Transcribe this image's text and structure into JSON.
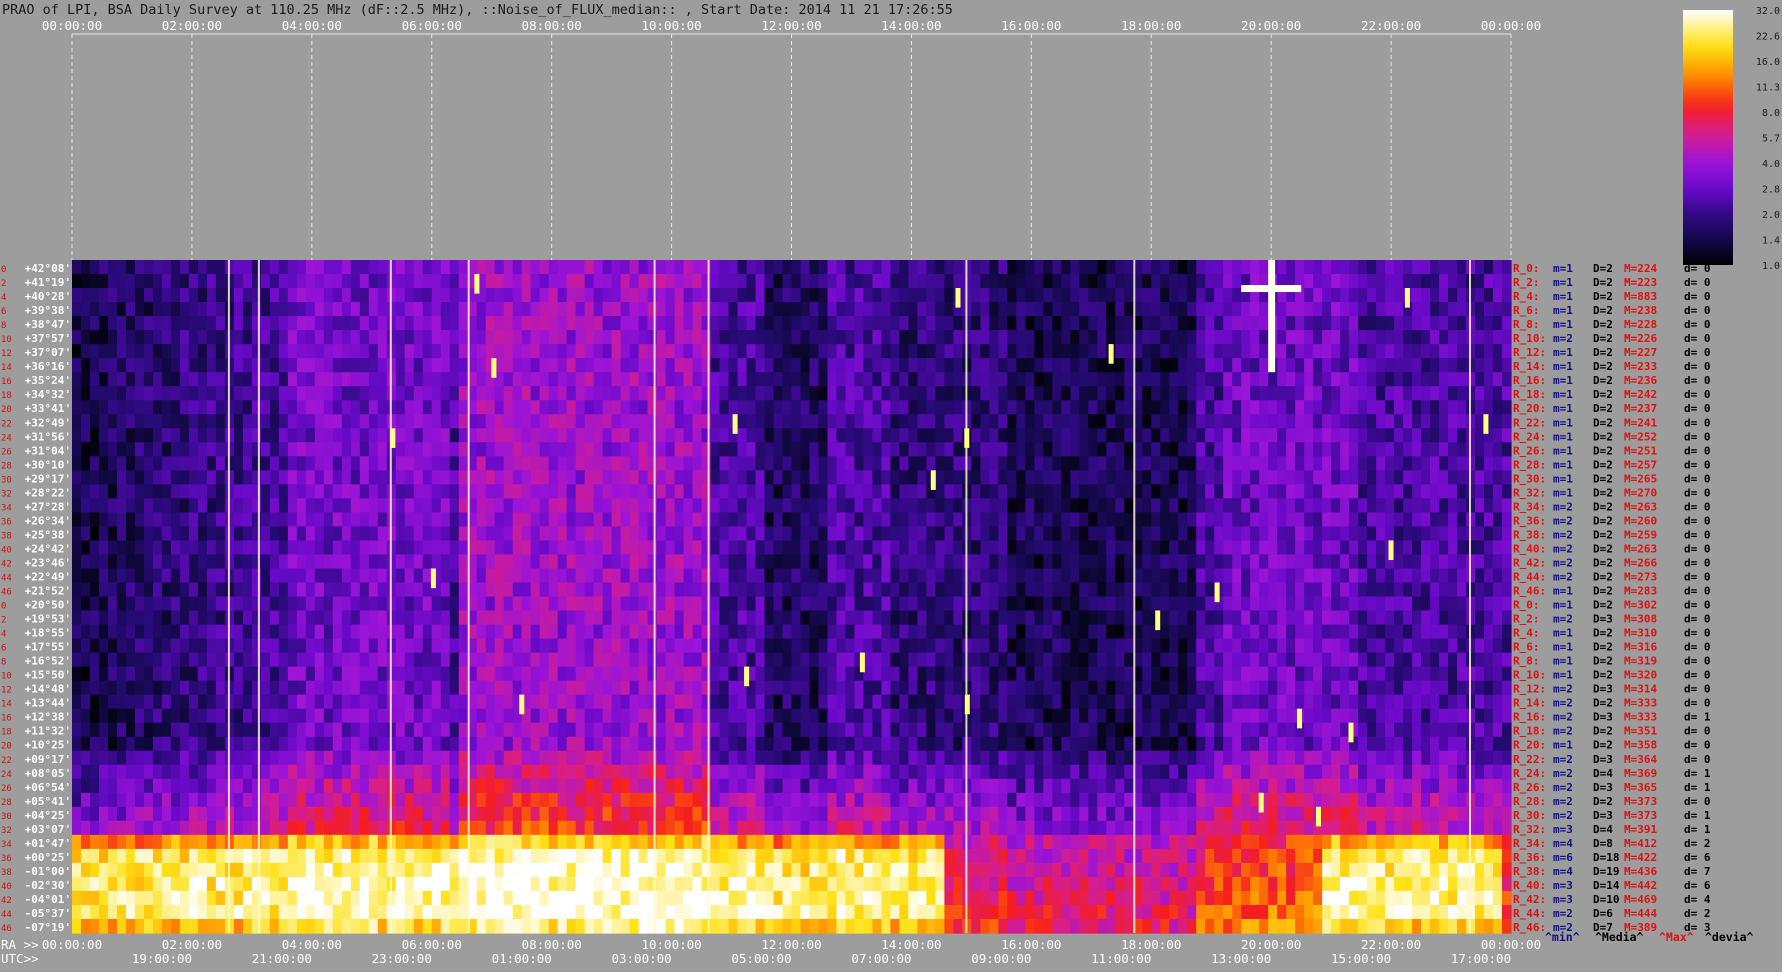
{
  "title": "PRAO of LPI, BSA Daily Survey at 110.25 MHz (dF::2.5 MHz), ::Noise_of_FLUX_median:: , Start Date: 2014 11 21 17:26:55",
  "colors": {
    "background": "#9d9d9d",
    "title_text": "#1a1a1a",
    "axis_text": "#ffffff",
    "row_index_text": "#d01010",
    "declination_text": "#ffffff",
    "stats_red": "#e01010",
    "stats_blue": "#101080",
    "stats_black": "#000000",
    "legend_min": "#101080",
    "legend_media": "#000000",
    "legend_max": "#e01010",
    "legend_devia": "#000000"
  },
  "chart_data": {
    "type": "heatmap",
    "title": "PRAO of LPI, BSA Daily Survey at 110.25 MHz (dF::2.5 MHz), ::Noise_of_FLUX_median:: , Start Date: 2014 11 21 17:26:55",
    "x_top_ticks": [
      "00:00:00",
      "02:00:00",
      "04:00:00",
      "06:00:00",
      "08:00:00",
      "10:00:00",
      "12:00:00",
      "14:00:00",
      "16:00:00",
      "18:00:00",
      "20:00:00",
      "22:00:00",
      "00:00:00"
    ],
    "x_bottom_ra_label": "RA >>",
    "x_bottom_ra_ticks": [
      "00:00:00",
      "02:00:00",
      "04:00:00",
      "06:00:00",
      "08:00:00",
      "10:00:00",
      "12:00:00",
      "14:00:00",
      "16:00:00",
      "18:00:00",
      "20:00:00",
      "22:00:00",
      "00:00:00"
    ],
    "x_bottom_utc_label": "UTC>>",
    "x_bottom_utc_ticks": [
      "19:00:00",
      "21:00:00",
      "23:00:00",
      "01:00:00",
      "03:00:00",
      "05:00:00",
      "07:00:00",
      "09:00:00",
      "11:00:00",
      "13:00:00",
      "15:00:00",
      "17:00:00"
    ],
    "x_range_hours": [
      0,
      24
    ],
    "colorbar": {
      "labels": [
        "32.0",
        "22.6",
        "16.0",
        "11.3",
        "8.0",
        "5.7",
        "4.0",
        "2.8",
        "2.0",
        "1.4",
        "1.0"
      ],
      "scale": "log2",
      "range": [
        1.0,
        32.0
      ]
    },
    "rows": [
      {
        "idx": "0",
        "dec": "+42°08'",
        "stats": [
          "R_0:",
          "m=1",
          "D=2",
          "M=224",
          "d= 0"
        ]
      },
      {
        "idx": "2",
        "dec": "+41°19'",
        "stats": [
          "R_2:",
          "m=1",
          "D=2",
          "M=223",
          "d= 0"
        ]
      },
      {
        "idx": "4",
        "dec": "+40°28'",
        "stats": [
          "R_4:",
          "m=1",
          "D=2",
          "M=883",
          "d= 0"
        ]
      },
      {
        "idx": "6",
        "dec": "+39°38'",
        "stats": [
          "R_6:",
          "m=1",
          "D=2",
          "M=238",
          "d= 0"
        ]
      },
      {
        "idx": "8",
        "dec": "+38°47'",
        "stats": [
          "R_8:",
          "m=1",
          "D=2",
          "M=228",
          "d= 0"
        ]
      },
      {
        "idx": "10",
        "dec": "+37°57'",
        "stats": [
          "R_10:",
          "m=2",
          "D=2",
          "M=226",
          "d= 0"
        ]
      },
      {
        "idx": "12",
        "dec": "+37°07'",
        "stats": [
          "R_12:",
          "m=1",
          "D=2",
          "M=227",
          "d= 0"
        ]
      },
      {
        "idx": "14",
        "dec": "+36°16'",
        "stats": [
          "R_14:",
          "m=1",
          "D=2",
          "M=233",
          "d= 0"
        ]
      },
      {
        "idx": "16",
        "dec": "+35°24'",
        "stats": [
          "R_16:",
          "m=1",
          "D=2",
          "M=236",
          "d= 0"
        ]
      },
      {
        "idx": "18",
        "dec": "+34°32'",
        "stats": [
          "R_18:",
          "m=1",
          "D=2",
          "M=242",
          "d= 0"
        ]
      },
      {
        "idx": "20",
        "dec": "+33°41'",
        "stats": [
          "R_20:",
          "m=1",
          "D=2",
          "M=237",
          "d= 0"
        ]
      },
      {
        "idx": "22",
        "dec": "+32°49'",
        "stats": [
          "R_22:",
          "m=1",
          "D=2",
          "M=241",
          "d= 0"
        ]
      },
      {
        "idx": "24",
        "dec": "+31°56'",
        "stats": [
          "R_24:",
          "m=1",
          "D=2",
          "M=252",
          "d= 0"
        ]
      },
      {
        "idx": "26",
        "dec": "+31°04'",
        "stats": [
          "R_26:",
          "m=1",
          "D=2",
          "M=251",
          "d= 0"
        ]
      },
      {
        "idx": "28",
        "dec": "+30°10'",
        "stats": [
          "R_28:",
          "m=1",
          "D=2",
          "M=257",
          "d= 0"
        ]
      },
      {
        "idx": "30",
        "dec": "+29°17'",
        "stats": [
          "R_30:",
          "m=1",
          "D=2",
          "M=265",
          "d= 0"
        ]
      },
      {
        "idx": "32",
        "dec": "+28°22'",
        "stats": [
          "R_32:",
          "m=1",
          "D=2",
          "M=270",
          "d= 0"
        ]
      },
      {
        "idx": "34",
        "dec": "+27°28'",
        "stats": [
          "R_34:",
          "m=2",
          "D=2",
          "M=263",
          "d= 0"
        ]
      },
      {
        "idx": "36",
        "dec": "+26°34'",
        "stats": [
          "R_36:",
          "m=2",
          "D=2",
          "M=260",
          "d= 0"
        ]
      },
      {
        "idx": "38",
        "dec": "+25°38'",
        "stats": [
          "R_38:",
          "m=2",
          "D=2",
          "M=259",
          "d= 0"
        ]
      },
      {
        "idx": "40",
        "dec": "+24°42'",
        "stats": [
          "R_40:",
          "m=2",
          "D=2",
          "M=263",
          "d= 0"
        ]
      },
      {
        "idx": "42",
        "dec": "+23°46'",
        "stats": [
          "R_42:",
          "m=2",
          "D=2",
          "M=266",
          "d= 0"
        ]
      },
      {
        "idx": "44",
        "dec": "+22°49'",
        "stats": [
          "R_44:",
          "m=2",
          "D=2",
          "M=273",
          "d= 0"
        ]
      },
      {
        "idx": "46",
        "dec": "+21°52'",
        "stats": [
          "R_46:",
          "m=1",
          "D=2",
          "M=283",
          "d= 0"
        ]
      },
      {
        "idx": "0",
        "dec": "+20°50'",
        "stats": [
          "R_0:",
          "m=1",
          "D=2",
          "M=302",
          "d= 0"
        ]
      },
      {
        "idx": "2",
        "dec": "+19°53'",
        "stats": [
          "R_2:",
          "m=2",
          "D=3",
          "M=308",
          "d= 0"
        ]
      },
      {
        "idx": "4",
        "dec": "+18°55'",
        "stats": [
          "R_4:",
          "m=1",
          "D=2",
          "M=310",
          "d= 0"
        ]
      },
      {
        "idx": "6",
        "dec": "+17°55'",
        "stats": [
          "R_6:",
          "m=1",
          "D=2",
          "M=316",
          "d= 0"
        ]
      },
      {
        "idx": "8",
        "dec": "+16°52'",
        "stats": [
          "R_8:",
          "m=1",
          "D=2",
          "M=319",
          "d= 0"
        ]
      },
      {
        "idx": "10",
        "dec": "+15°50'",
        "stats": [
          "R_10:",
          "m=1",
          "D=2",
          "M=320",
          "d= 0"
        ]
      },
      {
        "idx": "12",
        "dec": "+14°48'",
        "stats": [
          "R_12:",
          "m=2",
          "D=3",
          "M=314",
          "d= 0"
        ]
      },
      {
        "idx": "14",
        "dec": "+13°44'",
        "stats": [
          "R_14:",
          "m=2",
          "D=2",
          "M=333",
          "d= 0"
        ]
      },
      {
        "idx": "16",
        "dec": "+12°38'",
        "stats": [
          "R_16:",
          "m=2",
          "D=3",
          "M=333",
          "d= 1"
        ]
      },
      {
        "idx": "18",
        "dec": "+11°32'",
        "stats": [
          "R_18:",
          "m=2",
          "D=2",
          "M=351",
          "d= 0"
        ]
      },
      {
        "idx": "20",
        "dec": "+10°25'",
        "stats": [
          "R_20:",
          "m=1",
          "D=2",
          "M=358",
          "d= 0"
        ]
      },
      {
        "idx": "22",
        "dec": "+09°17'",
        "stats": [
          "R_22:",
          "m=2",
          "D=3",
          "M=364",
          "d= 0"
        ]
      },
      {
        "idx": "24",
        "dec": "+08°05'",
        "stats": [
          "R_24:",
          "m=2",
          "D=4",
          "M=369",
          "d= 1"
        ]
      },
      {
        "idx": "26",
        "dec": "+06°54'",
        "stats": [
          "R_26:",
          "m=2",
          "D=3",
          "M=365",
          "d= 1"
        ]
      },
      {
        "idx": "28",
        "dec": "+05°41'",
        "stats": [
          "R_28:",
          "m=2",
          "D=2",
          "M=373",
          "d= 0"
        ]
      },
      {
        "idx": "30",
        "dec": "+04°25'",
        "stats": [
          "R_30:",
          "m=2",
          "D=3",
          "M=373",
          "d= 1"
        ]
      },
      {
        "idx": "32",
        "dec": "+03°07'",
        "stats": [
          "R_32:",
          "m=3",
          "D=4",
          "M=391",
          "d= 1"
        ]
      },
      {
        "idx": "34",
        "dec": "+01°47'",
        "stats": [
          "R_34:",
          "m=4",
          "D=8",
          "M=412",
          "d= 2"
        ]
      },
      {
        "idx": "36",
        "dec": "+00°25'",
        "stats": [
          "R_36:",
          "m=6",
          "D=18",
          "M=422",
          "d= 6"
        ]
      },
      {
        "idx": "38",
        "dec": "-01°00'",
        "stats": [
          "R_38:",
          "m=4",
          "D=19",
          "M=436",
          "d= 7"
        ]
      },
      {
        "idx": "40",
        "dec": "-02°30'",
        "stats": [
          "R_40:",
          "m=3",
          "D=14",
          "M=442",
          "d= 6"
        ]
      },
      {
        "idx": "42",
        "dec": "-04°01'",
        "stats": [
          "R_42:",
          "m=3",
          "D=10",
          "M=469",
          "d= 4"
        ]
      },
      {
        "idx": "44",
        "dec": "-05°37'",
        "stats": [
          "R_44:",
          "m=2",
          "D=6",
          "M=444",
          "d= 2"
        ]
      },
      {
        "idx": "46",
        "dec": "-07°19'",
        "stats": [
          "R_46:",
          "m=2",
          "D=7",
          "M=389",
          "d= 3"
        ]
      }
    ],
    "legend_bottom": {
      "min": "^min^",
      "media": "^Media^",
      "max": "^Max^",
      "devia": "^devia^"
    }
  }
}
